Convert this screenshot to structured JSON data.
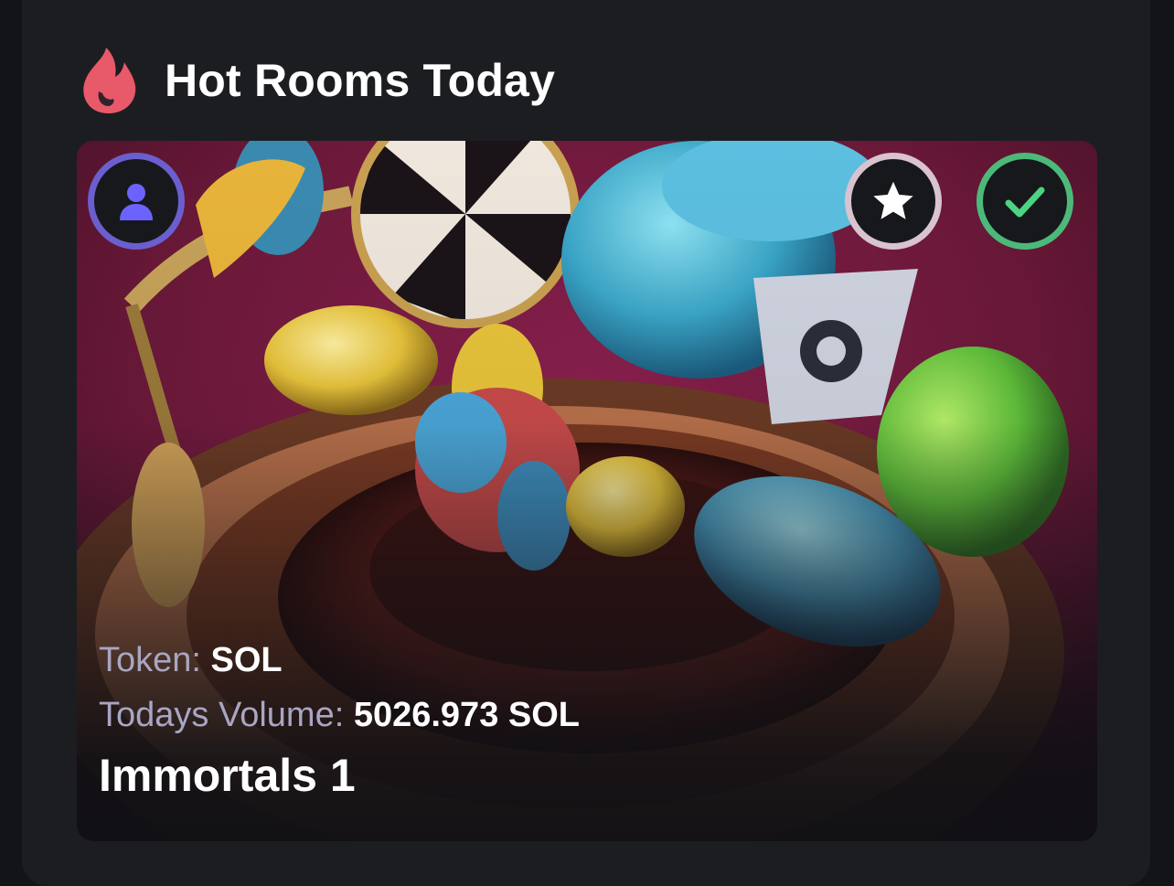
{
  "header": {
    "icon": "fire-icon",
    "title": "Hot Rooms Today",
    "icon_color": "#e8596a"
  },
  "room": {
    "token_label": "Token: ",
    "token_value": "SOL",
    "volume_label": "Todays Volume: ",
    "volume_value": "5026.973 SOL",
    "name": "Immortals 1",
    "badges": [
      {
        "icon": "user-icon",
        "ring_color": "#6b5fcf",
        "icon_color": "#6c63ff"
      },
      {
        "icon": "star-icon",
        "ring_color": "#d8c3cf",
        "icon_color": "#ffffff"
      },
      {
        "icon": "check-icon",
        "ring_color": "#4cb97a",
        "icon_color": "#4cd483"
      }
    ]
  }
}
